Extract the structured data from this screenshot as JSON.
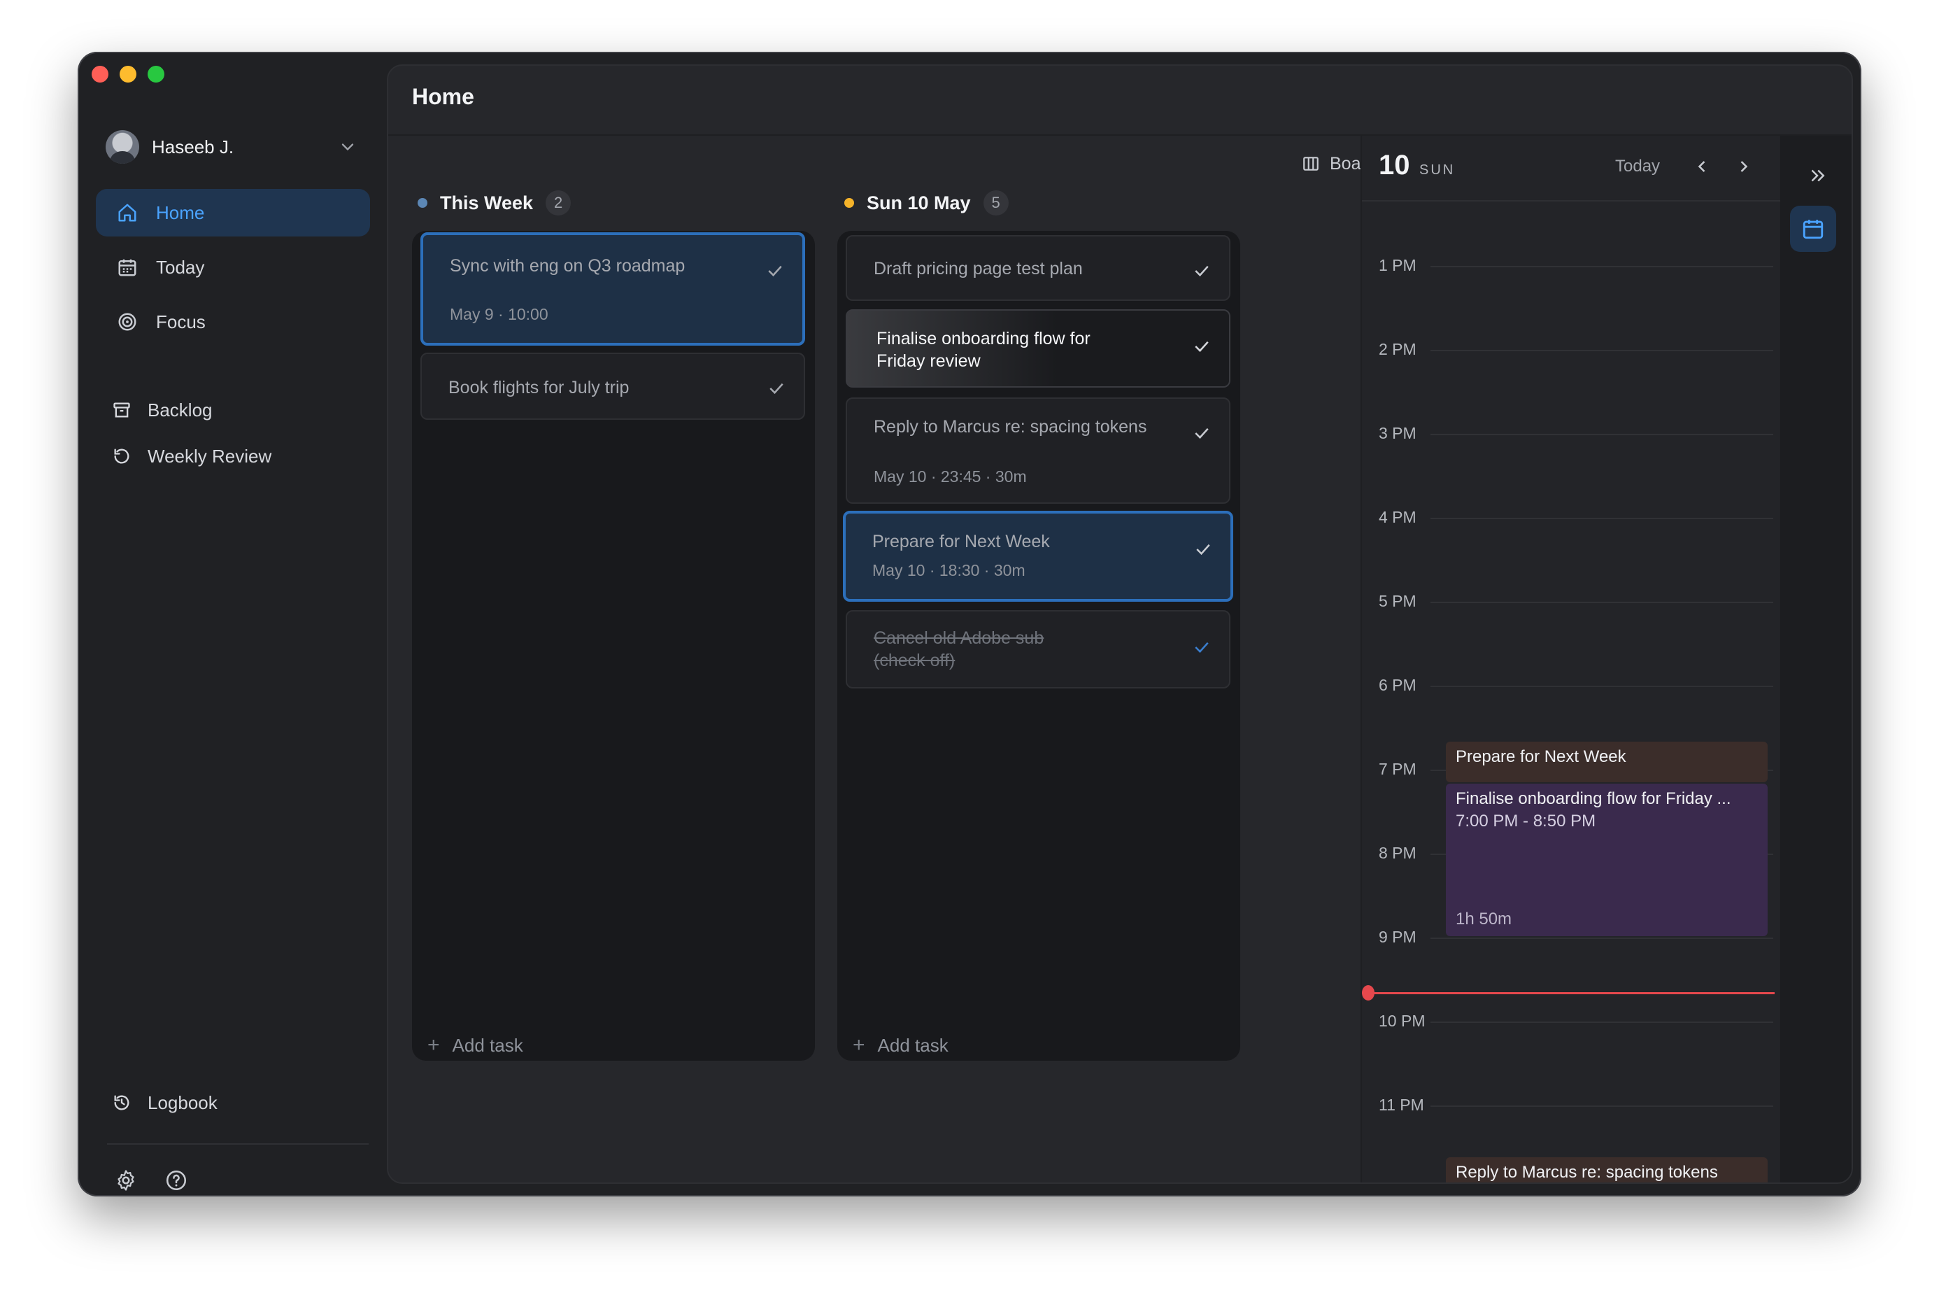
{
  "window": {
    "title": "Home"
  },
  "sidebar": {
    "user": {
      "name": "Haseeb J."
    },
    "items": [
      {
        "label": "Home",
        "icon": "home-icon",
        "active": true
      },
      {
        "label": "Today",
        "icon": "calendar-icon"
      },
      {
        "label": "Focus",
        "icon": "target-icon"
      }
    ],
    "lists": [
      {
        "label": "Backlog",
        "icon": "archive-icon"
      },
      {
        "label": "Weekly Review",
        "icon": "refresh-icon"
      }
    ],
    "footer_item": {
      "label": "Logbook",
      "icon": "history-icon"
    },
    "footer_icons": [
      "gear-icon",
      "help-icon"
    ]
  },
  "toolbar": {
    "view_label": "Board"
  },
  "columns": [
    {
      "title": "This Week",
      "count": "2",
      "dot_color": "#5c87b5",
      "cards": [
        {
          "title": "Sync with eng on Q3 roadmap",
          "meta": "May 9 · 10:00",
          "state": "selected"
        },
        {
          "title": "Book flights for July trip",
          "meta": "",
          "state": "normal"
        }
      ],
      "add_label": "Add task"
    },
    {
      "title": "Sun 10 May",
      "count": "5",
      "dot_color": "#f5b32a",
      "cards": [
        {
          "title": "Draft pricing page test plan",
          "meta": "",
          "state": "normal"
        },
        {
          "title": "Finalise onboarding flow for Friday review",
          "meta": "",
          "state": "highlight"
        },
        {
          "title": "Reply to Marcus re: spacing tokens",
          "meta": "May 10 · 23:45 · 30m",
          "state": "normal"
        },
        {
          "title": "Prepare for Next Week",
          "meta": "May 10 · 18:30 · 30m",
          "state": "selected"
        },
        {
          "title": "Cancel old Adobe sub (check off)",
          "meta": "",
          "state": "done"
        }
      ],
      "add_label": "Add task"
    }
  ],
  "calendar": {
    "day_num": "10",
    "day_name": "SUN",
    "today_label": "Today",
    "hours": [
      "1 PM",
      "2 PM",
      "3 PM",
      "4 PM",
      "5 PM",
      "6 PM",
      "7 PM",
      "8 PM",
      "9 PM",
      "10 PM",
      "11 PM"
    ],
    "now_line_color": "#e5484d",
    "events": [
      {
        "title": "Prepare for Next Week",
        "time": "",
        "duration": "",
        "color": "#3b2d2a"
      },
      {
        "title": "Finalise onboarding flow for Friday ...",
        "time": "7:00 PM - 8:50 PM",
        "duration": "1h 50m",
        "color": "#3a2a4d"
      },
      {
        "title": "Reply to Marcus re: spacing tokens",
        "time": "",
        "duration": "",
        "color": "#3b2d2a"
      }
    ]
  },
  "colors": {
    "accent": "#4aa3ff",
    "traffic": [
      "#ff5f57",
      "#febc2e",
      "#28c840"
    ]
  }
}
